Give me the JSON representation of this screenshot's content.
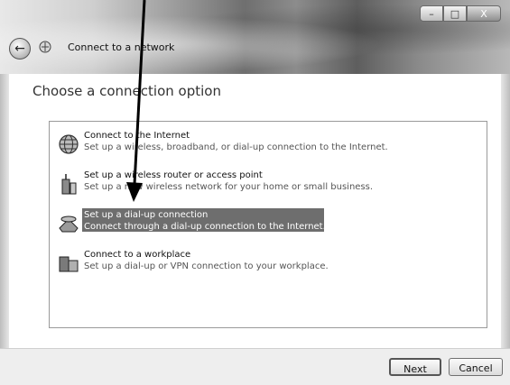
{
  "window": {
    "title": "Connect to a network",
    "icons": {
      "back": "back-arrow-icon",
      "network": "network-icon"
    },
    "caption": {
      "minimize": "–",
      "maximize": "□",
      "close": "X"
    }
  },
  "main": {
    "heading": "Choose a connection option",
    "options": [
      {
        "title": "Connect to the Internet",
        "description": "Set up a wireless, broadband, or dial-up connection to the Internet.",
        "icon": "globe-icon",
        "selected": false
      },
      {
        "title": "Set up a wireless router or access point",
        "description": "Set up a new wireless network for your home or small business.",
        "icon": "router-icon",
        "selected": false
      },
      {
        "title": "Set up a dial-up connection",
        "description": "Connect through a dial-up connection to the Internet.",
        "icon": "phone-icon",
        "selected": true
      },
      {
        "title": "Connect to a workplace",
        "description": "Set up a dial-up or VPN connection to your workplace.",
        "icon": "workplace-icon",
        "selected": false
      }
    ]
  },
  "footer": {
    "next_label": "Next",
    "cancel_label": "Cancel"
  },
  "colors": {
    "selection": "#6e6e6e",
    "text": "#111111",
    "secondary_text": "#555555"
  }
}
